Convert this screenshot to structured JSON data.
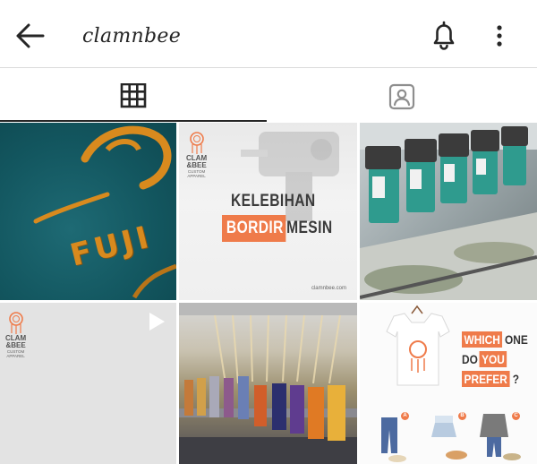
{
  "header": {
    "username": "clamnbee",
    "back_icon": "arrow-left-icon",
    "notification_icon": "bell-icon",
    "more_icon": "more-vertical-icon"
  },
  "tabs": [
    {
      "name": "posts-grid",
      "icon": "grid-icon",
      "active": true
    },
    {
      "name": "tagged",
      "icon": "person-tag-icon",
      "active": false
    }
  ],
  "posts": [
    {
      "id": 1,
      "kind": "photo",
      "embroidery_text": "FUJI"
    },
    {
      "id": 2,
      "kind": "photo",
      "brand_name_line1": "CLAM",
      "brand_name_line2": "&BEE",
      "brand_sub_line1": "CUSTOM",
      "brand_sub_line2": "APPAREL",
      "title_line1": "KELEBIHAN",
      "title_highlight": "BORDIR",
      "title_rest": "MESIN",
      "site": "clamnbee.com"
    },
    {
      "id": 3,
      "kind": "photo"
    },
    {
      "id": 4,
      "kind": "video",
      "brand_name_line1": "CLAM",
      "brand_name_line2": "&BEE",
      "brand_sub_line1": "CUSTOM",
      "brand_sub_line2": "APPAREL",
      "play_icon": "play-icon"
    },
    {
      "id": 5,
      "kind": "photo"
    },
    {
      "id": 6,
      "kind": "photo",
      "line1_highlight": "WHICH",
      "line1_rest": "ONE",
      "line2_plain": "DO",
      "line2_highlight": "YOU",
      "line3_highlight": "PREFER",
      "line3_rest": "?",
      "options": [
        "A",
        "B",
        "C"
      ]
    }
  ],
  "colors": {
    "accent": "#ef7b4a",
    "text": "#262626",
    "divider": "#dbdbdb",
    "teal_fabric": "#135760",
    "embroidery_gold": "#d88a1e"
  }
}
